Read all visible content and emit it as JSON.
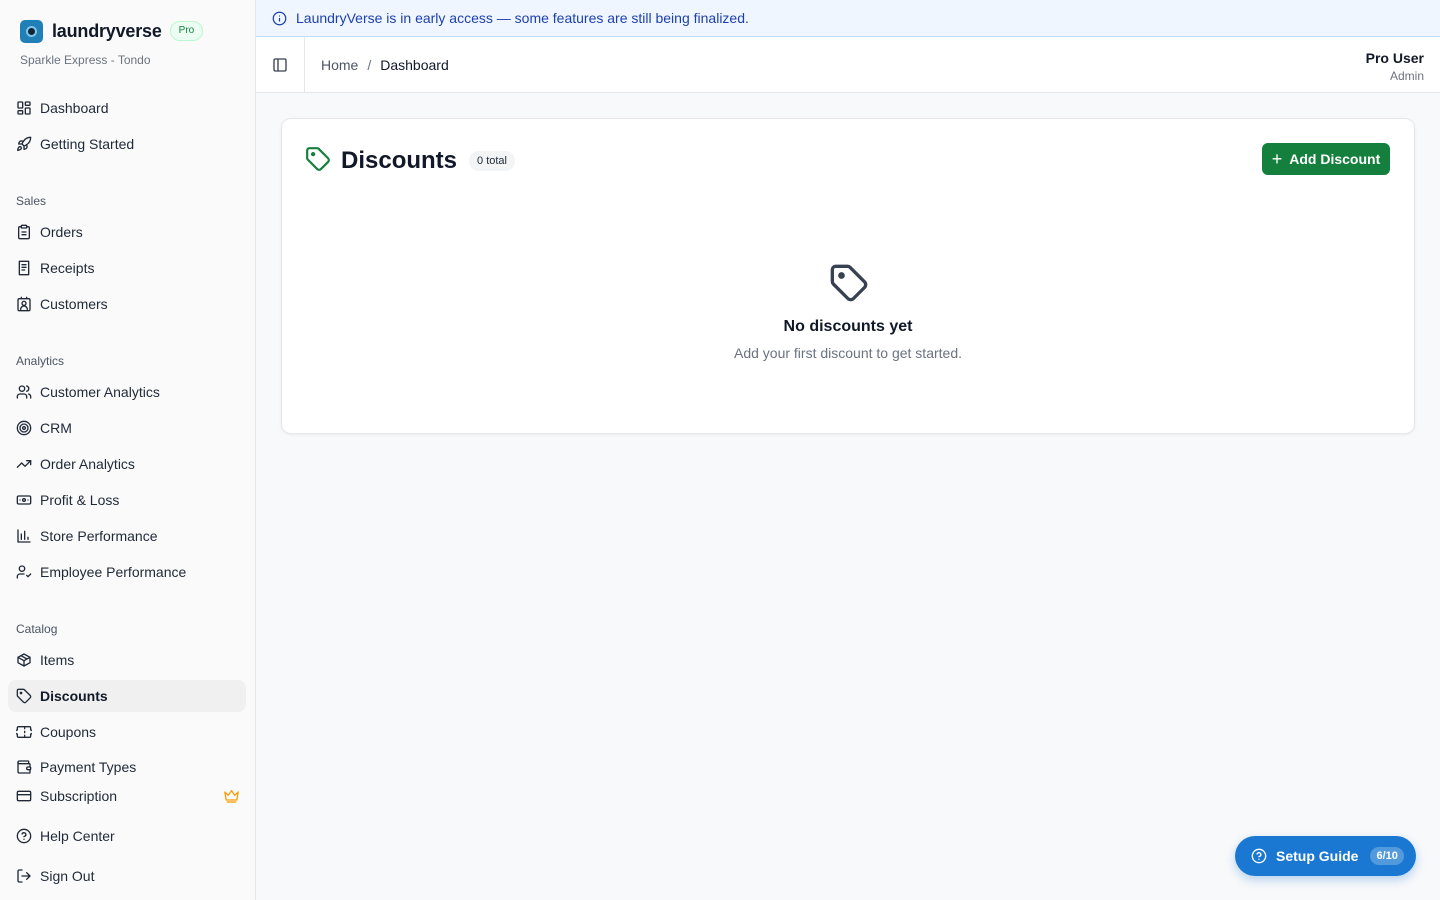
{
  "app": {
    "name": "laundryverse",
    "plan_badge": "Pro",
    "store": "Sparkle Express - Tondo"
  },
  "banner": {
    "text": "LaundryVerse is in early access — some features are still being finalized.",
    "icon": "info-icon"
  },
  "sidebar": {
    "top_items": [
      {
        "label": "Dashboard",
        "icon": "layout-dashboard-icon"
      },
      {
        "label": "Getting Started",
        "icon": "rocket-icon"
      }
    ],
    "sections": [
      {
        "title": "Sales",
        "items": [
          {
            "label": "Orders",
            "icon": "clipboard-icon"
          },
          {
            "label": "Receipts",
            "icon": "receipt-icon"
          },
          {
            "label": "Customers",
            "icon": "contact-icon"
          }
        ]
      },
      {
        "title": "Analytics",
        "items": [
          {
            "label": "Customer Analytics",
            "icon": "users-icon"
          },
          {
            "label": "CRM",
            "icon": "target-icon"
          },
          {
            "label": "Order Analytics",
            "icon": "trending-up-icon"
          },
          {
            "label": "Profit & Loss",
            "icon": "banknote-icon"
          },
          {
            "label": "Store Performance",
            "icon": "bar-chart-icon"
          },
          {
            "label": "Employee Performance",
            "icon": "user-check-icon"
          }
        ]
      },
      {
        "title": "Catalog",
        "items": [
          {
            "label": "Items",
            "icon": "package-icon"
          },
          {
            "label": "Discounts",
            "icon": "tag-icon",
            "active": true
          },
          {
            "label": "Coupons",
            "icon": "ticket-icon"
          },
          {
            "label": "Payment Types",
            "icon": "wallet-icon"
          }
        ]
      }
    ],
    "bottom_items": [
      {
        "label": "Subscription",
        "icon": "credit-card-icon",
        "badge_icon": "crown-icon"
      },
      {
        "label": "Help Center",
        "icon": "help-circle-icon"
      },
      {
        "label": "Sign Out",
        "icon": "log-out-icon"
      }
    ]
  },
  "header": {
    "breadcrumb": {
      "home": "Home",
      "separator": "/",
      "current": "Dashboard"
    },
    "user": {
      "name": "Pro User",
      "role": "Admin"
    }
  },
  "discounts": {
    "title": "Discounts",
    "count_badge": "0 total",
    "add_button": "Add Discount",
    "add_button_icon": "+",
    "empty_title": "No discounts yet",
    "empty_subtitle": "Add your first discount to get started."
  },
  "setup_guide": {
    "label": "Setup Guide",
    "progress": "6/10"
  },
  "colors": {
    "primary_green": "#15803d",
    "setup_blue": "#1a78d2",
    "banner_bg": "#eff6ff",
    "banner_text": "#1e40af",
    "crown": "#f59e0b"
  }
}
